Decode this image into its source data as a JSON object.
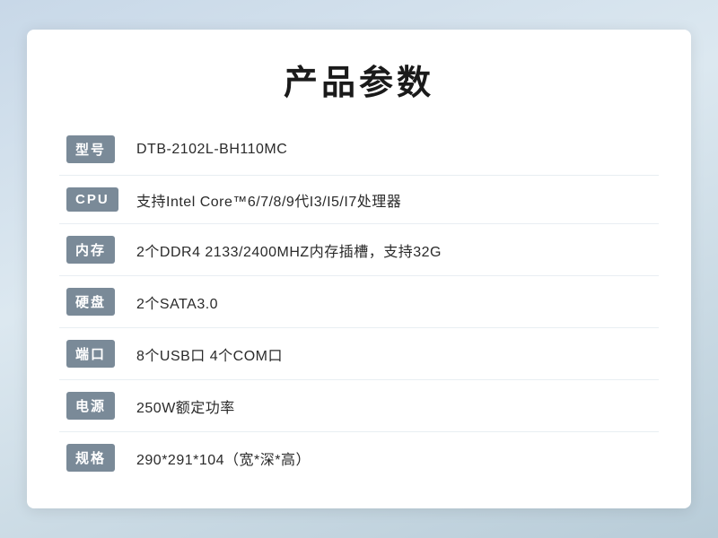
{
  "page": {
    "title": "产品参数",
    "rows": [
      {
        "label": "型号",
        "value": " DTB-2102L-BH110MC"
      },
      {
        "label": "CPU",
        "value": "支持Intel Core™6/7/8/9代I3/I5/I7处理器"
      },
      {
        "label": "内存",
        "value": "2个DDR4 2133/2400MHZ内存插槽，支持32G"
      },
      {
        "label": "硬盘",
        "value": "2个SATA3.0"
      },
      {
        "label": "端口",
        "value": "8个USB口 4个COM口"
      },
      {
        "label": "电源",
        "value": "250W额定功率"
      },
      {
        "label": "规格",
        "value": "290*291*104（宽*深*高）"
      }
    ]
  }
}
